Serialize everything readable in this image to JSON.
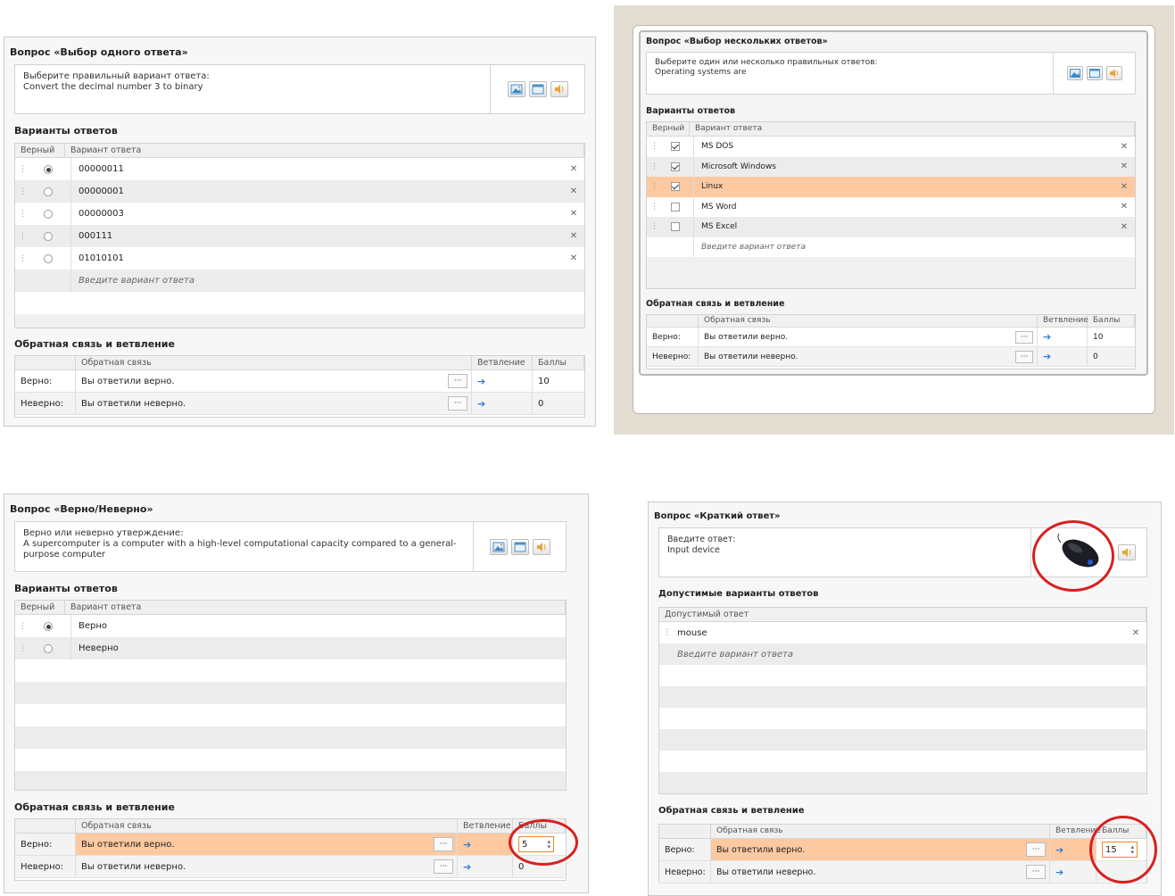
{
  "icons": {
    "image": "image-icon",
    "window": "window-icon",
    "sound": "speaker-icon",
    "remove": "close-icon",
    "goto": "arrow-right-icon"
  },
  "colors": {
    "highlight": "#fdc9a0",
    "accent_circle": "#d62121",
    "arrow": "#2f7fd0"
  },
  "p1": {
    "title": "Вопрос «Выбор одного ответа»",
    "question": [
      "Выберите правильный вариант ответа:",
      "Convert the decimal number 3 to binary"
    ],
    "answers_title": "Варианты ответов",
    "col_correct": "Верный",
    "col_answer": "Вариант ответа",
    "rows": [
      {
        "text": "00000011",
        "checked": true
      },
      {
        "text": "00000001",
        "checked": false
      },
      {
        "text": "00000003",
        "checked": false
      },
      {
        "text": "000111",
        "checked": false
      },
      {
        "text": "01010101",
        "checked": false
      }
    ],
    "placeholder": "Введите вариант ответа",
    "fb_title": "Обратная связь и ветвление",
    "fb_col": "Обратная связь",
    "br_col": "Ветвление",
    "pts_col": "Баллы",
    "fb_rows": [
      {
        "label": "Верно:",
        "text": "Вы ответили верно.",
        "points": "10"
      },
      {
        "label": "Неверно:",
        "text": "Вы ответили неверно.",
        "points": "0"
      }
    ]
  },
  "p2": {
    "title": "Вопрос «Выбор нескольких ответов»",
    "question": [
      "Выберите один или несколько правильных ответов:",
      "Operating systems are"
    ],
    "answers_title": "Варианты ответов",
    "col_correct": "Верный",
    "col_answer": "Вариант ответа",
    "rows": [
      {
        "text": "MS DOS",
        "checked": true
      },
      {
        "text": "Microsoft Windows",
        "checked": true
      },
      {
        "text": "Linux",
        "checked": true
      },
      {
        "text": "MS Word",
        "checked": false
      },
      {
        "text": "MS Excel",
        "checked": false
      }
    ],
    "placeholder": "Введите вариант ответа",
    "fb_title": "Обратная связь и ветвление",
    "fb_col": "Обратная связь",
    "br_col": "Ветвление",
    "pts_col": "Баллы",
    "fb_rows": [
      {
        "label": "Верно:",
        "text": "Вы ответили верно.",
        "points": "10"
      },
      {
        "label": "Неверно:",
        "text": "Вы ответили неверно.",
        "points": "0"
      }
    ]
  },
  "p3": {
    "title": "Вопрос «Верно/Неверно»",
    "question": [
      "Верно или неверно утверждение:",
      "A supercomputer is   a computer with a high-level computational capacity compared to a general-",
      "purpose computer"
    ],
    "answers_title": "Варианты ответов",
    "col_correct": "Верный",
    "col_answer": "Вариант ответа",
    "rows": [
      {
        "text": "Верно",
        "checked": true
      },
      {
        "text": "Неверно",
        "checked": false
      }
    ],
    "fb_title": "Обратная связь и ветвление",
    "fb_col": "Обратная связь",
    "br_col": "Ветвление",
    "pts_col": "Баллы",
    "fb_rows": [
      {
        "label": "Верно:",
        "text": "Вы ответили верно.",
        "points": "5"
      },
      {
        "label": "Неверно:",
        "text": "Вы ответили неверно.",
        "points": "0"
      }
    ]
  },
  "p4": {
    "title": "Вопрос «Краткий ответ»",
    "question": [
      "Введите ответ:",
      "Input device"
    ],
    "answers_title": "Допустимые варианты ответов",
    "col_answer": "Допустимый ответ",
    "rows": [
      {
        "text": "mouse"
      }
    ],
    "placeholder": "Введите вариант ответа",
    "fb_title": "Обратная связь и ветвление",
    "fb_col": "Обратная связь",
    "br_col": "Ветвление",
    "pts_col": "Баллы",
    "fb_rows": [
      {
        "label": "Верно:",
        "text": "Вы ответили верно.",
        "points": "15"
      },
      {
        "label": "Неверно:",
        "text": "Вы ответили неверно.",
        "points": ""
      }
    ]
  }
}
